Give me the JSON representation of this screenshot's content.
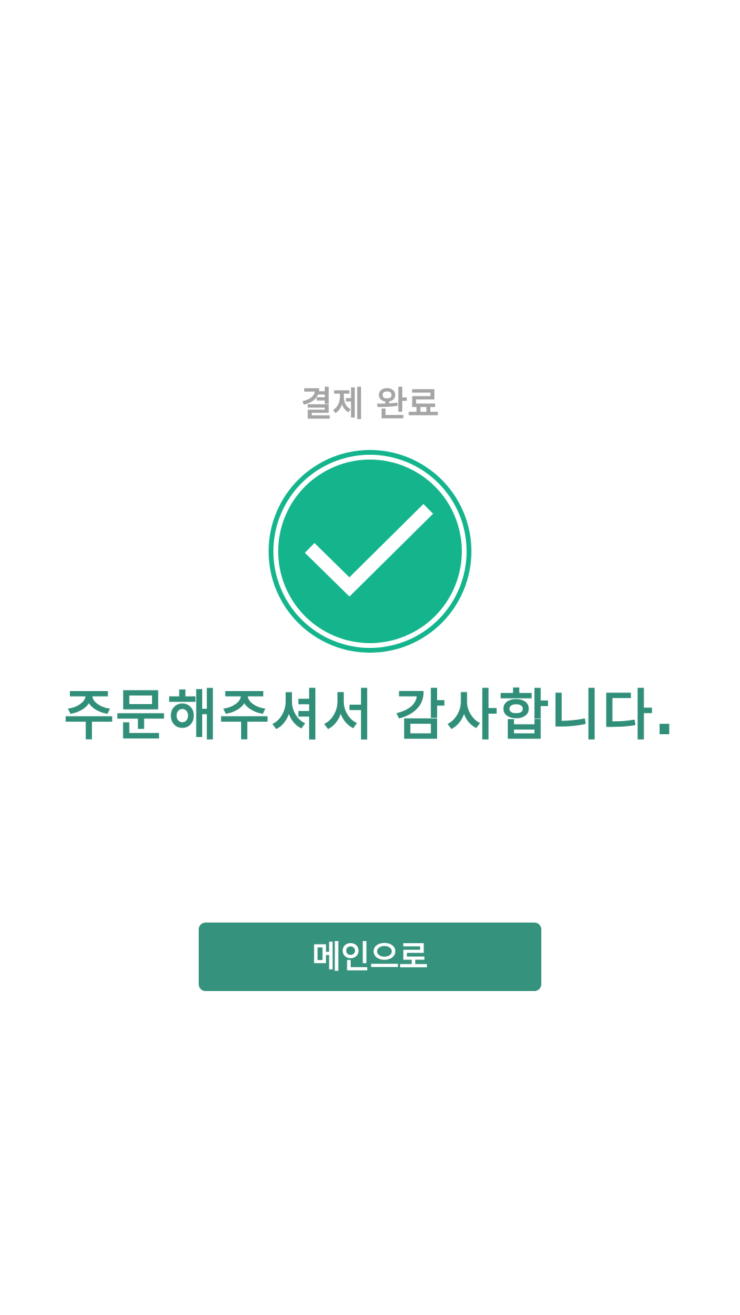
{
  "status": {
    "title": "결제 완료",
    "icon": "check-circle-icon"
  },
  "message": {
    "text": "주문해주셔서 감사합니다."
  },
  "actions": {
    "main_button_label": "메인으로"
  },
  "colors": {
    "accent": "#14b58c",
    "primary_text": "#318f79",
    "button_bg": "#34927d",
    "muted_text": "#a5a5a5",
    "background": "#ffffff"
  }
}
